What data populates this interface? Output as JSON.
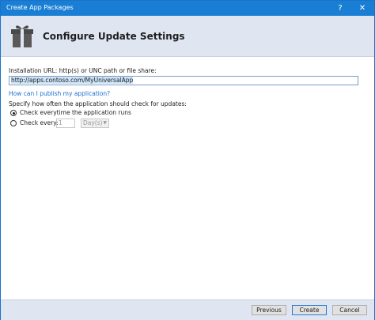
{
  "window": {
    "title": "Create App Packages",
    "help_glyph": "?",
    "close_glyph": "✕"
  },
  "header": {
    "title": "Configure Update Settings",
    "icon": "package-gift-icon"
  },
  "form": {
    "install_url_label": "Installation URL: http(s) or UNC path or file share:",
    "install_url_value": "http://apps.contoso.com/MyUniversalApp",
    "publish_link": "How can I publish my application?",
    "frequency_label": "Specify how often the application should check for updates:",
    "option_every_run": "Check everytime the application runs",
    "option_every_run_checked": true,
    "option_every": "Check every:",
    "option_every_checked": false,
    "every_value": "1",
    "every_unit": "Day(s)"
  },
  "footer": {
    "previous_label": "Previous",
    "create_label": "Create",
    "cancel_label": "Cancel"
  }
}
